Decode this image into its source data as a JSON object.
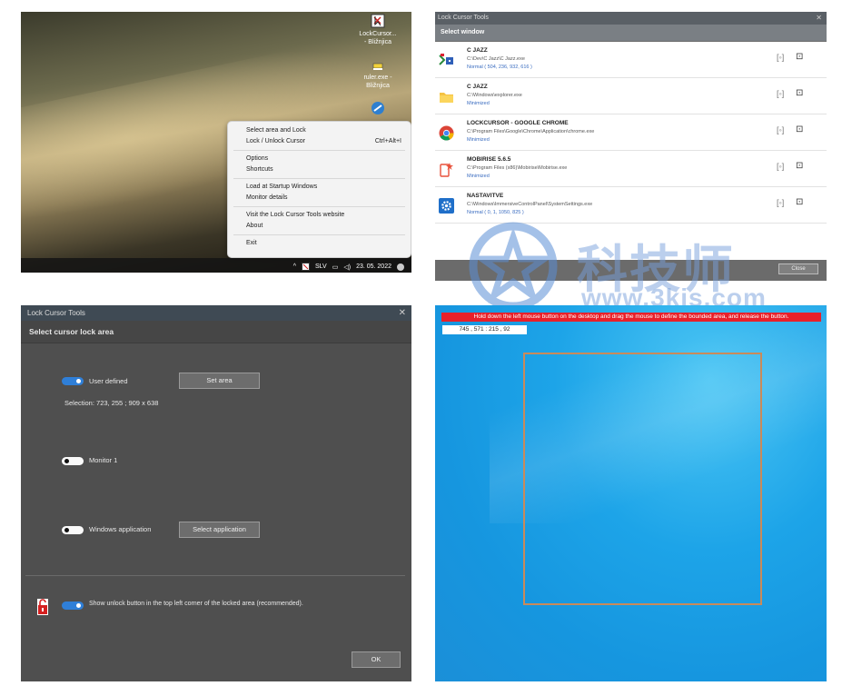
{
  "panel1": {
    "desktop_icons": [
      {
        "label": "LockCursor...\n- Bližnjica",
        "icon": "lock-cursor-icon"
      },
      {
        "label": "ruler.exe -\nBližnjica",
        "icon": "ruler-icon"
      }
    ],
    "context_menu": [
      {
        "label": "Select area and Lock",
        "shortcut": ""
      },
      {
        "label": "Lock / Unlock Cursor",
        "shortcut": "Ctrl+Alt+I"
      },
      {
        "label": "Options",
        "shortcut": ""
      },
      {
        "label": "Shortcuts",
        "shortcut": ""
      },
      {
        "label": "Load at Startup Windows",
        "shortcut": ""
      },
      {
        "label": "Monitor details",
        "shortcut": ""
      },
      {
        "label": "Visit the Lock Cursor Tools website",
        "shortcut": ""
      },
      {
        "label": "About",
        "shortcut": ""
      },
      {
        "label": "Exit",
        "shortcut": ""
      }
    ],
    "tray": {
      "lang": "SLV",
      "date": "23. 05. 2022"
    }
  },
  "panel2": {
    "title": "Lock Cursor Tools",
    "subtitle": "Select window",
    "windows": [
      {
        "title": "C JAZZ",
        "path": "C:\\Dev\\C Jazz\\C Jazz.exe",
        "state": "Normal ( 504, 236, 932, 616 )",
        "icon": "cjazz-app-icon"
      },
      {
        "title": "C JAZZ",
        "path": "C:\\Windows\\explorer.exe",
        "state": "Minimized",
        "icon": "folder-icon"
      },
      {
        "title": "LOCKCURSOR - GOOGLE CHROME",
        "path": "C:\\Program Files\\Google\\Chrome\\Application\\chrome.exe",
        "state": "Minimized",
        "icon": "chrome-icon"
      },
      {
        "title": "MOBIRISE 5.6.5",
        "path": "C:\\Program Files (x86)\\Mobirise\\Mobirise.exe",
        "state": "Minimized",
        "icon": "mobirise-icon"
      },
      {
        "title": "NASTAVITVE",
        "path": "C:\\Windows\\ImmersiveControlPanel\\SystemSettings.exe",
        "state": "Normal ( 0, 1, 1050, 825 )",
        "icon": "settings-gear-icon"
      }
    ],
    "close_label": "Close"
  },
  "watermark": {
    "text": "科技师",
    "url": "www.3kjs.com"
  },
  "panel3": {
    "title": "Lock Cursor Tools",
    "heading": "Select cursor lock area",
    "user_defined_label": "User defined",
    "set_area_label": "Set area",
    "selection_text": "Selection: 723, 255 ; 909 x 638",
    "monitor_label": "Monitor 1",
    "windows_app_label": "Windows application",
    "select_app_label": "Select application",
    "unlock_label": "Show unlock button in the top left corner of the locked area (recommended).",
    "ok_label": "OK",
    "toggles": {
      "user_defined": true,
      "monitor": false,
      "windows_app": false,
      "unlock": true
    }
  },
  "panel4": {
    "hint": "Hold down the left mouse button on the desktop and drag the mouse to define the bounded area, and release the button.",
    "coords": "745 , 571 : 215 , 92"
  }
}
